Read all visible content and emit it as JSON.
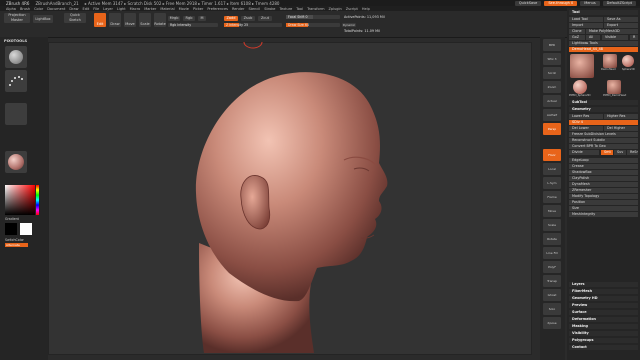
{
  "titlebar": {
    "app": "ZBrush 4R6",
    "file": "ZBrushAndBranch_21",
    "stats": "▸ Active Mem 3147 ▸ Scratch Disk 502 ▸ Free Mem 2918 ▸ Timer 1.617 ▸ Item 6108 ▸ Tmem 4280",
    "quicksave": "QuickSave",
    "seethrough": "See-through  0",
    "menus_btn": "Menus",
    "default_script": "DefaultZScript"
  },
  "menubar": [
    "Alpha",
    "Brush",
    "Color",
    "Document",
    "Draw",
    "Edit",
    "File",
    "Layer",
    "Light",
    "Macro",
    "Marker",
    "Material",
    "Movie",
    "Picker",
    "Preferences",
    "Render",
    "Stencil",
    "Stroke",
    "Texture",
    "Tool",
    "Transform",
    "Zplugin",
    "Zscript",
    "Help"
  ],
  "toolbar": {
    "projection_master": "Projection Master",
    "lightbox": "LightBox",
    "quick_sketch": "Quick Sketch",
    "edit": "Edit",
    "draw": "Draw",
    "move": "Move",
    "scale": "Scale",
    "rotate": "Rotate",
    "mrgb": "Mrgb",
    "rgb": "Rgb",
    "m": "M",
    "zadd": "Zadd",
    "zsub": "Zsub",
    "zcut": "Zcut",
    "rgb_intensity": "Rgb Intensity",
    "z_intensity": "Z Intensity 25",
    "focal_shift": "Focal Shift 0",
    "draw_size": "Draw Size 64",
    "dynamic": "Dynamic",
    "active_points": "ActivePoints: 11,093 Mil",
    "total_points": "TotalPoints: 11.09 Mil"
  },
  "left_tray": {
    "header": "PIXOTOOLS",
    "gradient": "Gradient",
    "switch_color": "SwitchColor",
    "alternate": "Alternate",
    "colors": {
      "primary": "#000000",
      "secondary": "#ffffff",
      "alternate": "#e8641a"
    }
  },
  "right_shelf": [
    "BPR",
    "SPix 3",
    "Scroll",
    "Zoom",
    "Actual",
    "AAHalf",
    "Persp",
    "Floor",
    "Local",
    "L.Sym",
    "Frame",
    "Move",
    "Scale",
    "Rotate",
    "Line Fill",
    "PolyF",
    "Transp",
    "Ghost",
    "Solo",
    "Xpose"
  ],
  "tool_palette": {
    "title": "Tool",
    "load_tool": "Load Tool",
    "save_as": "Save As",
    "import": "Import",
    "export": "Export",
    "clone": "Clone",
    "make_polymesh": "Make PolyMesh3D",
    "goz": "GoZ",
    "all": "All",
    "visible": "Visible",
    "r": "R",
    "lightbox_tools": "Lightbox▸ Tools",
    "current_tool": "DemoHead_44_48",
    "thumbs": [
      "DemoHead",
      "Sphere3D",
      "PM3D_Sphere3D",
      "PM3D_DemoHead"
    ],
    "subtool": "SubTool",
    "geometry": "Geometry",
    "lower_res": "Lower Res",
    "higher_res": "Higher Res",
    "sdiv": "SDiv 4",
    "del_lower": "Del Lower",
    "del_higher": "Del Higher",
    "freeze_subdiv": "Freeze SubDivision Levels",
    "reconstruct": "Reconstruct Subdiv",
    "convert_bpr": "Convert BPR To Geo",
    "divide": "Divide",
    "smt": "Smt",
    "suv": "Suv",
    "rsmt": "ReSmt",
    "sections": [
      "EdgeLoop",
      "Crease",
      "ShadowBox",
      "ClayPolish",
      "DynaMesh",
      "ZRemesher",
      "Modify Topology",
      "Position",
      "Size",
      "MeshIntegrity"
    ],
    "more": [
      "Layers",
      "FiberMesh",
      "Geometry HD",
      "Preview",
      "Surface",
      "Deformation",
      "Masking",
      "Visibility",
      "Polygroups",
      "Contact"
    ]
  }
}
